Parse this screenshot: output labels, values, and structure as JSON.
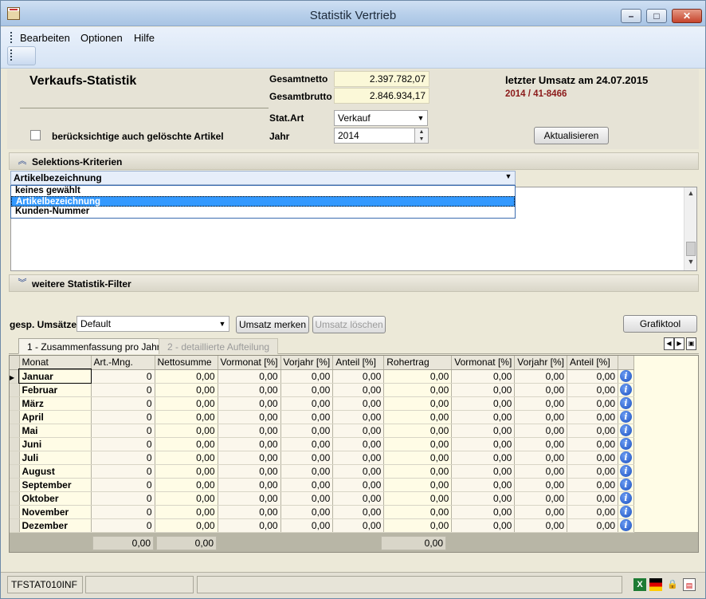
{
  "window": {
    "title": "Statistik Vertrieb",
    "minimize_glyph": "–",
    "maximize_glyph": "□",
    "close_glyph": "✕"
  },
  "menu": {
    "items": [
      "Bearbeiten",
      "Optionen",
      "Hilfe"
    ]
  },
  "header": {
    "page_title": "Verkaufs-Statistik",
    "gesamtnetto_label": "Gesamtnetto",
    "gesamtnetto_value": "2.397.782,07",
    "gesamtbrutto_label": "Gesamtbrutto",
    "gesamtbrutto_value": "2.846.934,17",
    "last_sale_text": "letzter Umsatz am 24.07.2015",
    "last_sale_ref": "2014 / 41-8466",
    "stat_art_label": "Stat.Art",
    "stat_art_value": "Verkauf",
    "jahr_label": "Jahr",
    "jahr_value": "2014",
    "deleted_checkbox_label": "berücksichtige auch gelöschte Artikel",
    "refresh_button": "Aktualisieren"
  },
  "selection": {
    "panel_title": "Selektions-Kriterien",
    "selected_value": "Artikelbezeichnung",
    "options": [
      "keines gewählt",
      "Artikelbezeichnung",
      "Kunden-Nummer"
    ],
    "selected_index": 1,
    "filter_panel_title": "weitere Statistik-Filter"
  },
  "toolbar": {
    "gesp_label": "gesp. Umsätze",
    "gesp_value": "Default",
    "merken_button": "Umsatz merken",
    "loeschen_button": "Umsatz löschen",
    "grafik_button": "Grafiktool"
  },
  "tabs": [
    {
      "label": "1 - Zusammenfassung pro Jahr",
      "active": true
    },
    {
      "label": "2 - detaillierte Aufteilung",
      "active": false
    }
  ],
  "grid": {
    "columns": [
      "Monat",
      "Art.-Mng.",
      "Nettosumme",
      "Vormonat [%]",
      "Vorjahr [%]",
      "Anteil [%]",
      "Rohertrag",
      "Vormonat [%]",
      "Vorjahr [%]",
      "Anteil [%]"
    ],
    "rows": [
      {
        "month": "Januar",
        "menge": "0",
        "netto": "0,00",
        "vm": "0,00",
        "vj": "0,00",
        "ant": "0,00",
        "roh": "0,00",
        "vm2": "0,00",
        "vj2": "0,00",
        "ant2": "0,00"
      },
      {
        "month": "Februar",
        "menge": "0",
        "netto": "0,00",
        "vm": "0,00",
        "vj": "0,00",
        "ant": "0,00",
        "roh": "0,00",
        "vm2": "0,00",
        "vj2": "0,00",
        "ant2": "0,00"
      },
      {
        "month": "März",
        "menge": "0",
        "netto": "0,00",
        "vm": "0,00",
        "vj": "0,00",
        "ant": "0,00",
        "roh": "0,00",
        "vm2": "0,00",
        "vj2": "0,00",
        "ant2": "0,00"
      },
      {
        "month": "April",
        "menge": "0",
        "netto": "0,00",
        "vm": "0,00",
        "vj": "0,00",
        "ant": "0,00",
        "roh": "0,00",
        "vm2": "0,00",
        "vj2": "0,00",
        "ant2": "0,00"
      },
      {
        "month": "Mai",
        "menge": "0",
        "netto": "0,00",
        "vm": "0,00",
        "vj": "0,00",
        "ant": "0,00",
        "roh": "0,00",
        "vm2": "0,00",
        "vj2": "0,00",
        "ant2": "0,00"
      },
      {
        "month": "Juni",
        "menge": "0",
        "netto": "0,00",
        "vm": "0,00",
        "vj": "0,00",
        "ant": "0,00",
        "roh": "0,00",
        "vm2": "0,00",
        "vj2": "0,00",
        "ant2": "0,00"
      },
      {
        "month": "Juli",
        "menge": "0",
        "netto": "0,00",
        "vm": "0,00",
        "vj": "0,00",
        "ant": "0,00",
        "roh": "0,00",
        "vm2": "0,00",
        "vj2": "0,00",
        "ant2": "0,00"
      },
      {
        "month": "August",
        "menge": "0",
        "netto": "0,00",
        "vm": "0,00",
        "vj": "0,00",
        "ant": "0,00",
        "roh": "0,00",
        "vm2": "0,00",
        "vj2": "0,00",
        "ant2": "0,00"
      },
      {
        "month": "September",
        "menge": "0",
        "netto": "0,00",
        "vm": "0,00",
        "vj": "0,00",
        "ant": "0,00",
        "roh": "0,00",
        "vm2": "0,00",
        "vj2": "0,00",
        "ant2": "0,00"
      },
      {
        "month": "Oktober",
        "menge": "0",
        "netto": "0,00",
        "vm": "0,00",
        "vj": "0,00",
        "ant": "0,00",
        "roh": "0,00",
        "vm2": "0,00",
        "vj2": "0,00",
        "ant2": "0,00"
      },
      {
        "month": "November",
        "menge": "0",
        "netto": "0,00",
        "vm": "0,00",
        "vj": "0,00",
        "ant": "0,00",
        "roh": "0,00",
        "vm2": "0,00",
        "vj2": "0,00",
        "ant2": "0,00"
      },
      {
        "month": "Dezember",
        "menge": "0",
        "netto": "0,00",
        "vm": "0,00",
        "vj": "0,00",
        "ant": "0,00",
        "roh": "0,00",
        "vm2": "0,00",
        "vj2": "0,00",
        "ant2": "0,00"
      }
    ],
    "totals": {
      "menge": "0,00",
      "netto": "0,00",
      "roh": "0,00"
    },
    "info_glyph": "i"
  },
  "statusbar": {
    "left_text": "TFSTAT010INF",
    "icons": [
      "excel-icon",
      "flag-de-icon",
      "lock-icon",
      "report-icon"
    ]
  },
  "colors": {
    "accent_red": "#8b1a1a",
    "selection_blue": "#3399ff",
    "grid_yellow": "#fffce6"
  }
}
